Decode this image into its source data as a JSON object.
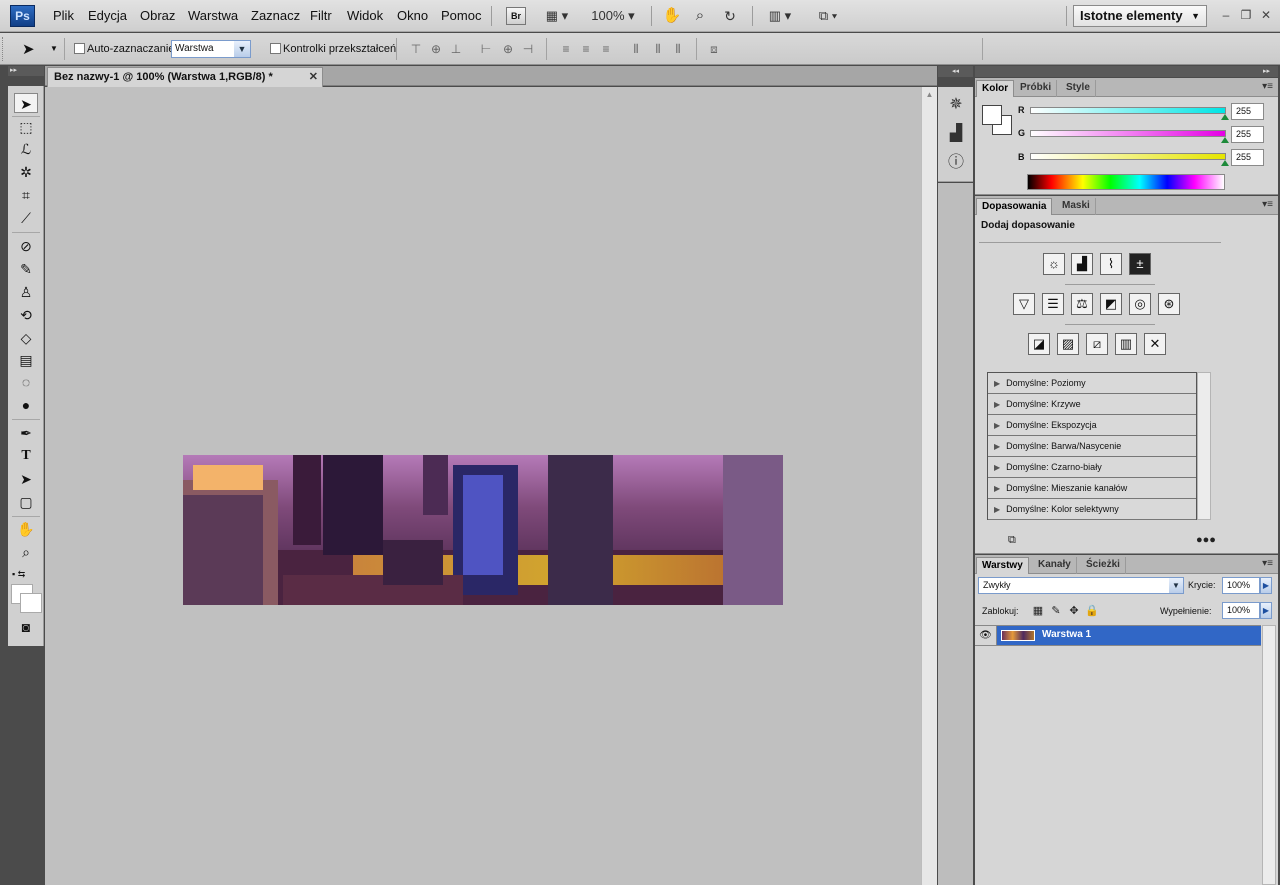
{
  "app": {
    "logo": "Ps",
    "menu": [
      "Plik",
      "Edycja",
      "Obraz",
      "Warstwa",
      "Zaznacz",
      "Filtr",
      "Widok",
      "Okno",
      "Pomoc"
    ],
    "bridge_label": "Br",
    "zoom": "100%",
    "workspace": "Istotne elementy"
  },
  "options_bar": {
    "auto_select_label": "Auto-zaznaczanie:",
    "auto_select_value": "Warstwa",
    "transform_controls_label": "Kontrolki przekształceń"
  },
  "document": {
    "tab_title": "Bez nazwy-1 @ 100% (Warstwa 1,RGB/8) *"
  },
  "color_panel": {
    "tabs": [
      "Kolor",
      "Próbki",
      "Style"
    ],
    "channels": [
      {
        "label": "R",
        "value": "255",
        "color": "#00e5e5"
      },
      {
        "label": "G",
        "value": "255",
        "color": "#e500e5"
      },
      {
        "label": "B",
        "value": "255",
        "color": "#e5e500"
      }
    ]
  },
  "adjustments_panel": {
    "tabs": [
      "Dopasowania",
      "Maski"
    ],
    "title": "Dodaj dopasowanie",
    "presets": [
      "Domyślne: Poziomy",
      "Domyślne: Krzywe",
      "Domyślne: Ekspozycja",
      "Domyślne: Barwa/Nasycenie",
      "Domyślne: Czarno-biały",
      "Domyślne: Mieszanie kanałów",
      "Domyślne: Kolor selektywny"
    ]
  },
  "layers_panel": {
    "tabs": [
      "Warstwy",
      "Kanały",
      "Ścieżki"
    ],
    "blend_mode": "Zwykły",
    "opacity_label": "Krycie:",
    "opacity_value": "100%",
    "lock_label": "Zablokuj:",
    "fill_label": "Wypełnienie:",
    "fill_value": "100%",
    "layers": [
      {
        "name": "Warstwa 1"
      }
    ]
  },
  "colors": {
    "accent": "#3167c6",
    "canvas_bg": "#c0c0c0",
    "panel_bg": "#d6d6d6"
  }
}
